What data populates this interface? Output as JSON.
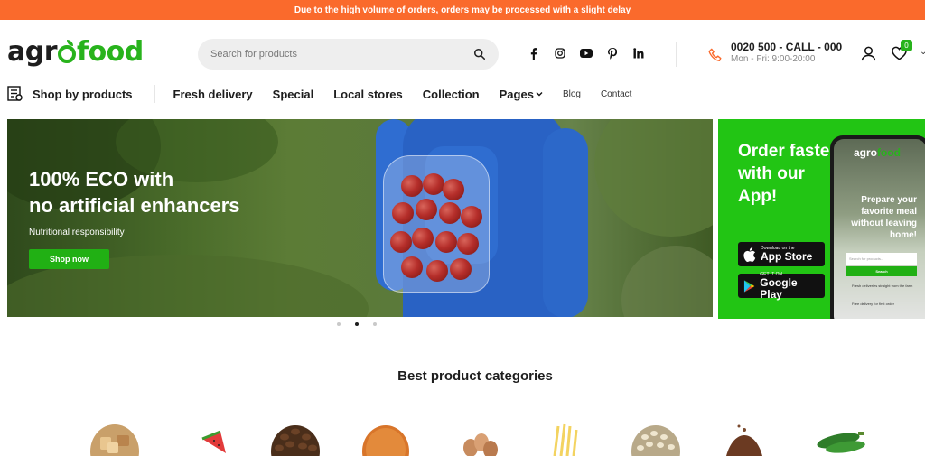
{
  "topbar": {
    "notice": "Due to the high volume of orders, orders may be processed with a slight delay"
  },
  "brand": {
    "logo_agro": "agr",
    "logo_food": "food",
    "accent": "#28b31c",
    "topbar_color": "#fa6a2c"
  },
  "search": {
    "placeholder": "Search for products"
  },
  "socials": [
    "facebook-icon",
    "instagram-icon",
    "youtube-icon",
    "pinterest-icon",
    "linkedin-icon"
  ],
  "contact": {
    "phone": "0020 500 - CALL - 000",
    "hours": "Mon - Fri: 9:00-20:00"
  },
  "cart": {
    "count": "0"
  },
  "nav": {
    "shop_by": "Shop by products",
    "links": [
      "Fresh delivery",
      "Special",
      "Local stores",
      "Collection",
      "Pages",
      "Blog",
      "Contact"
    ]
  },
  "hero": {
    "title_line1": "100% ECO with",
    "title_line2": "no artificial enhancers",
    "subtitle": "Nutritional responsibility",
    "button": "Shop now"
  },
  "promo": {
    "title": "Order faster with our App!",
    "appstore_small": "Download on the",
    "appstore_name": "App Store",
    "googleplay_small": "GET IT ON",
    "googleplay_name": "Google Play",
    "phone_logo_a": "agro",
    "phone_logo_b": "food",
    "phone_headline": "Prepare your favorite meal without leaving home!",
    "phone_search_placeholder": "Search for products...",
    "phone_search_button": "Search",
    "phone_feature_1": "Fresh deliveries straight from the farm",
    "phone_feature_2": "Free delivery for first order"
  },
  "categories": {
    "title": "Best product categories"
  }
}
